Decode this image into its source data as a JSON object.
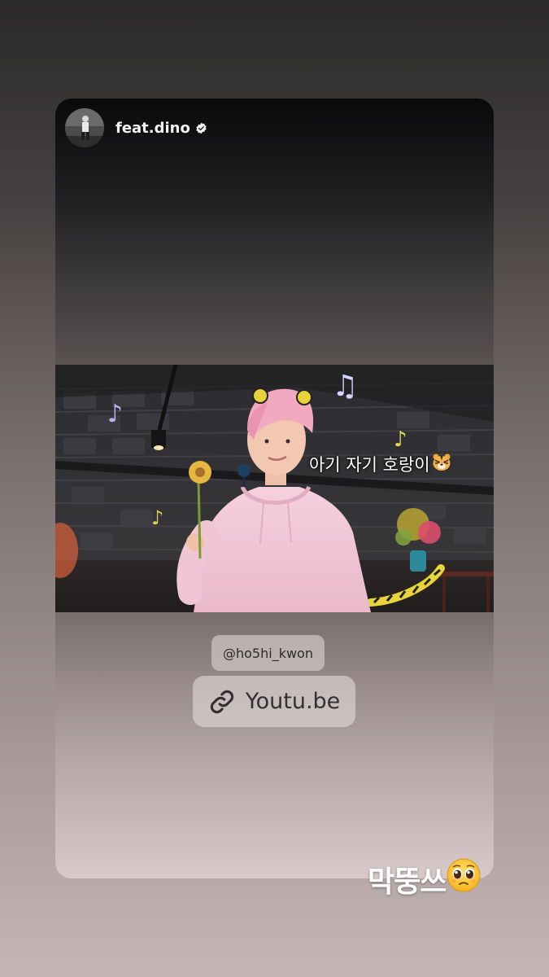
{
  "post": {
    "username": "feat.dino",
    "verified": true,
    "video_caption": "아기 자기 호랑이",
    "caption_emoji": "tiger-face",
    "mention": "@ho5hi_kwon",
    "link": {
      "label": "Youtu.be",
      "icon": "link-icon"
    }
  },
  "story": {
    "text": "막뚱쓰",
    "emoji": "pleading-face"
  },
  "colors": {
    "hoodie": "#f2c6d6",
    "hair": "#f4a6bd",
    "sticker_bg": "#e6dcdc"
  }
}
